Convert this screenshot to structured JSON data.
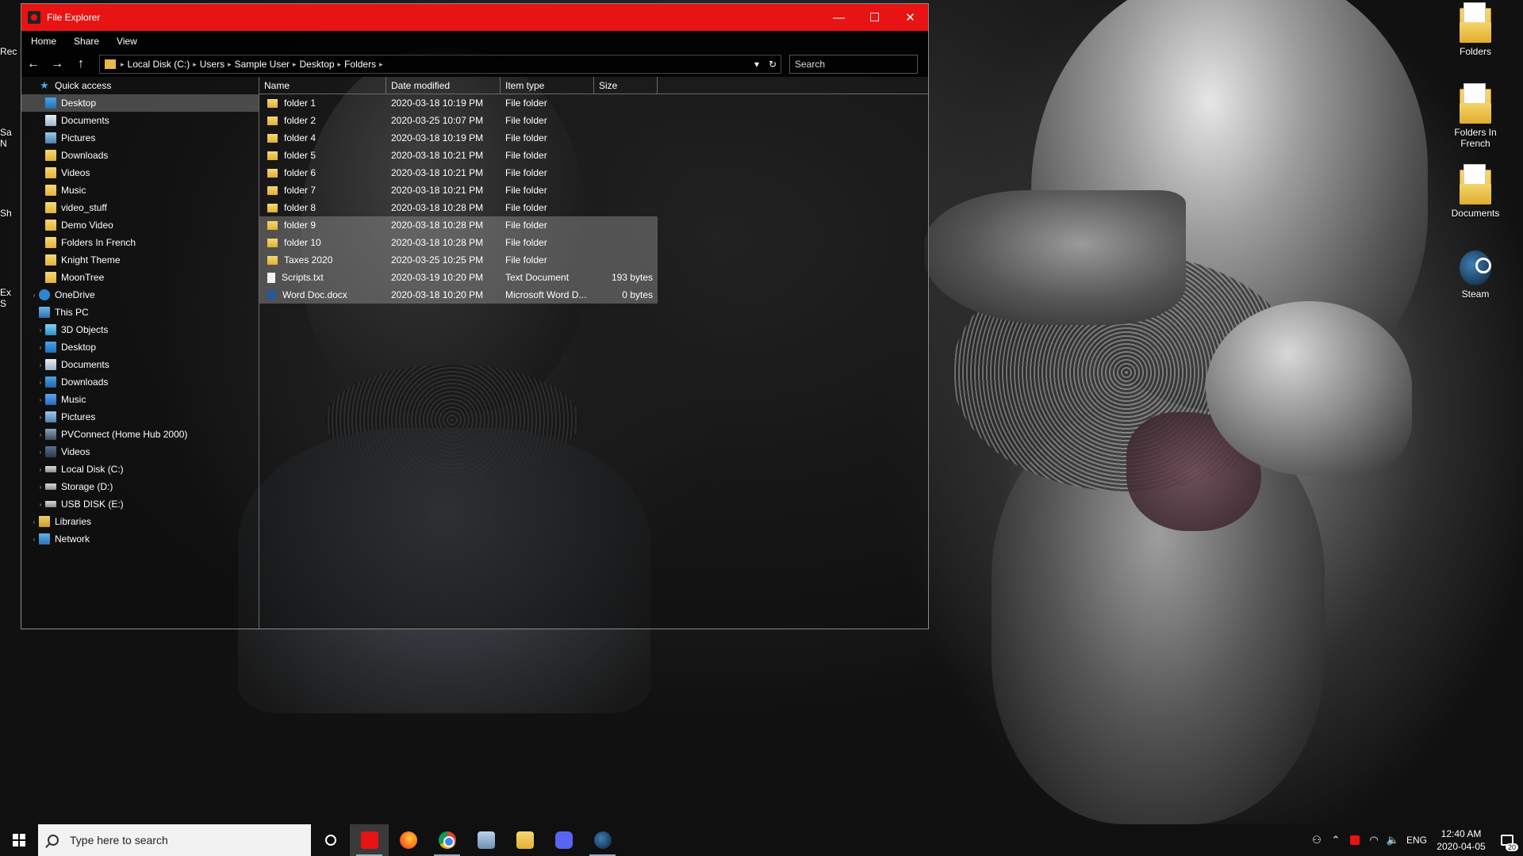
{
  "window": {
    "title": "File Explorer",
    "controls": {
      "minimize": "—",
      "maximize": "☐",
      "close": "✕"
    },
    "accent_color": "#e81313"
  },
  "menu": [
    "Home",
    "Share",
    "View"
  ],
  "nav": {
    "back": "←",
    "forward": "→",
    "up": "↑"
  },
  "address": {
    "crumbs": [
      "Local Disk (C:)",
      "Users",
      "Sample User",
      "Desktop",
      "Folders"
    ],
    "dropdown": "▾",
    "refresh": "↻"
  },
  "search": {
    "placeholder": "Search"
  },
  "tree": [
    {
      "label": "Quick access",
      "icon": "star-icon",
      "level": 0,
      "expander": ""
    },
    {
      "label": "Desktop",
      "icon": "desktop-icon",
      "level": 1,
      "selected": true
    },
    {
      "label": "Documents",
      "icon": "documents-icon",
      "level": 1
    },
    {
      "label": "Pictures",
      "icon": "pictures-icon",
      "level": 1
    },
    {
      "label": "Downloads",
      "icon": "folder-icon",
      "level": 1
    },
    {
      "label": "Videos",
      "icon": "folder-icon",
      "level": 1
    },
    {
      "label": "Music",
      "icon": "folder-icon",
      "level": 1
    },
    {
      "label": "video_stuff",
      "icon": "folder-icon",
      "level": 1
    },
    {
      "label": "Demo Video",
      "icon": "folder-icon",
      "level": 1
    },
    {
      "label": "Folders In French",
      "icon": "folder-icon",
      "level": 1
    },
    {
      "label": "Knight Theme",
      "icon": "folder-icon",
      "level": 1
    },
    {
      "label": "MoonTree",
      "icon": "folder-icon",
      "level": 1
    },
    {
      "label": "OneDrive",
      "icon": "cloud-icon",
      "level": 0,
      "expander": "›"
    },
    {
      "label": "This PC",
      "icon": "pc-icon",
      "level": 0,
      "expander": ""
    },
    {
      "label": "3D Objects",
      "icon": "cube-icon",
      "level": 1,
      "expander": "›"
    },
    {
      "label": "Desktop",
      "icon": "desktop-icon",
      "level": 1,
      "expander": "›"
    },
    {
      "label": "Documents",
      "icon": "documents-icon",
      "level": 1,
      "expander": "›"
    },
    {
      "label": "Downloads",
      "icon": "downloads-icon",
      "level": 1,
      "expander": "›"
    },
    {
      "label": "Music",
      "icon": "music-icon",
      "level": 1,
      "expander": "›"
    },
    {
      "label": "Pictures",
      "icon": "pictures-icon",
      "level": 1,
      "expander": "›"
    },
    {
      "label": "PVConnect (Home Hub 2000)",
      "icon": "media-server-icon",
      "level": 1,
      "expander": "›"
    },
    {
      "label": "Videos",
      "icon": "videos-icon",
      "level": 1,
      "expander": "›"
    },
    {
      "label": "Local Disk (C:)",
      "icon": "drive-icon",
      "level": 1,
      "expander": "›"
    },
    {
      "label": "Storage (D:)",
      "icon": "drive-icon",
      "level": 1,
      "expander": "›"
    },
    {
      "label": "USB DISK (E:)",
      "icon": "drive-icon",
      "level": 1,
      "expander": "›"
    },
    {
      "label": "Libraries",
      "icon": "libraries-icon",
      "level": 0,
      "expander": "›"
    },
    {
      "label": "Network",
      "icon": "network-icon",
      "level": 0,
      "expander": "›"
    }
  ],
  "columns": {
    "name": "Name",
    "date": "Date modified",
    "type": "Item type",
    "size": "Size"
  },
  "files": [
    {
      "name": "folder 1",
      "date": "2020-03-18 10:19 PM",
      "type": "File folder",
      "size": "",
      "icon": "folder-icon"
    },
    {
      "name": "folder 2",
      "date": "2020-03-25 10:07 PM",
      "type": "File folder",
      "size": "",
      "icon": "folder-icon"
    },
    {
      "name": "folder 4",
      "date": "2020-03-18 10:19 PM",
      "type": "File folder",
      "size": "",
      "icon": "folder-icon"
    },
    {
      "name": "folder 5",
      "date": "2020-03-18 10:21 PM",
      "type": "File folder",
      "size": "",
      "icon": "folder-icon"
    },
    {
      "name": "folder 6",
      "date": "2020-03-18 10:21 PM",
      "type": "File folder",
      "size": "",
      "icon": "folder-icon"
    },
    {
      "name": "folder 7",
      "date": "2020-03-18 10:21 PM",
      "type": "File folder",
      "size": "",
      "icon": "folder-icon"
    },
    {
      "name": "folder 8",
      "date": "2020-03-18 10:28 PM",
      "type": "File folder",
      "size": "",
      "icon": "folder-icon"
    },
    {
      "name": "folder 9",
      "date": "2020-03-18 10:28 PM",
      "type": "File folder",
      "size": "",
      "icon": "folder-icon",
      "selected": true
    },
    {
      "name": "folder 10",
      "date": "2020-03-18 10:28 PM",
      "type": "File folder",
      "size": "",
      "icon": "folder-icon",
      "selected": true
    },
    {
      "name": "Taxes 2020",
      "date": "2020-03-25 10:25 PM",
      "type": "File folder",
      "size": "",
      "icon": "folder-icon",
      "selected": true
    },
    {
      "name": "Scripts.txt",
      "date": "2020-03-19 10:20 PM",
      "type": "Text Document",
      "size": "193 bytes",
      "icon": "text-file-icon",
      "selected": true
    },
    {
      "name": "Word Doc.docx",
      "date": "2020-03-18 10:20 PM",
      "type": "Microsoft Word D...",
      "size": "0 bytes",
      "icon": "word-file-icon",
      "selected": true
    }
  ],
  "desktop_icons": [
    {
      "label": "Folders",
      "icon": "folder-icon"
    },
    {
      "label": "Folders In French",
      "icon": "folder-icon"
    },
    {
      "label": "Documents",
      "icon": "folder-icon"
    },
    {
      "label": "Steam",
      "icon": "steam-icon"
    }
  ],
  "desktop_left_cut": [
    "Rec",
    "Sa",
    "N",
    "Sh",
    "Ex",
    "S"
  ],
  "taskbar": {
    "search_placeholder": "Type here to search",
    "apps": [
      "camera-app-icon",
      "firefox-icon",
      "chrome-icon",
      "this-pc-icon",
      "file-explorer-icon",
      "discord-icon",
      "steam-icon"
    ],
    "language": "ENG",
    "time": "12:40 AM",
    "date": "2020-04-05",
    "notification_count": "20",
    "tray_glyphs": {
      "people": "⚇",
      "chevron": "⌃",
      "wifi": "◠",
      "volume": "🔈"
    }
  }
}
